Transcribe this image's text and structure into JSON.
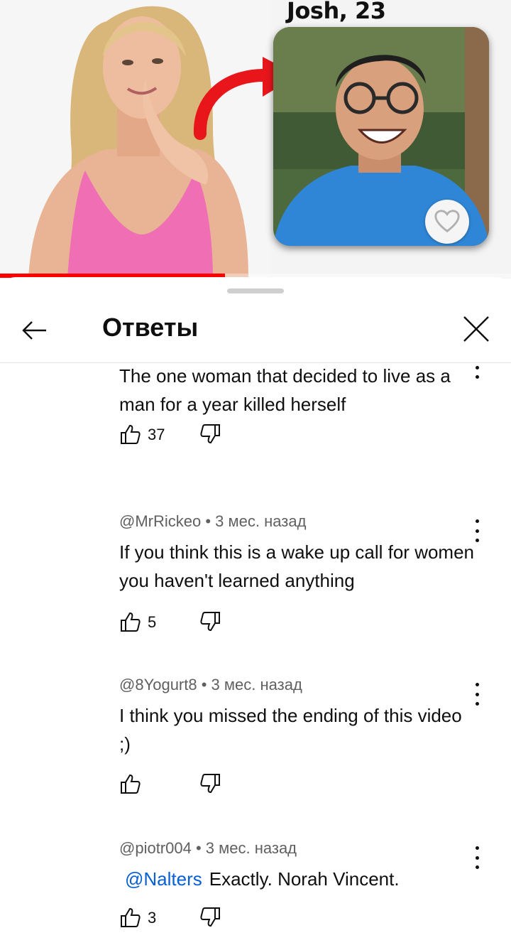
{
  "video": {
    "overlay_text": "Josh, 23",
    "progress": 0.44,
    "accent_color": "#ff0000"
  },
  "panel": {
    "title": "Ответы",
    "back_icon": "arrow-left-icon",
    "close_icon": "close-icon"
  },
  "comments": [
    {
      "author": "",
      "time": "",
      "text": "The one woman that decided to live as a man for a year killed herself",
      "likes": "37"
    },
    {
      "author": "@MrRickeo",
      "time": "3 мес. назад",
      "text": "If you think this is a wake up call for women you haven't learned anything",
      "likes": "5"
    },
    {
      "author": "@8Yogurt8",
      "time": "3 мес. назад",
      "text": "I think you missed the ending of this video ;)",
      "likes": ""
    },
    {
      "author": "@piotr004",
      "time": "3 мес. назад",
      "mention": "@Nalters",
      "text": "Exactly. Norah Vincent.",
      "likes": "3"
    }
  ],
  "colors": {
    "text": "#0f0f0f",
    "secondary_text": "#606060",
    "link": "#065fd4"
  }
}
